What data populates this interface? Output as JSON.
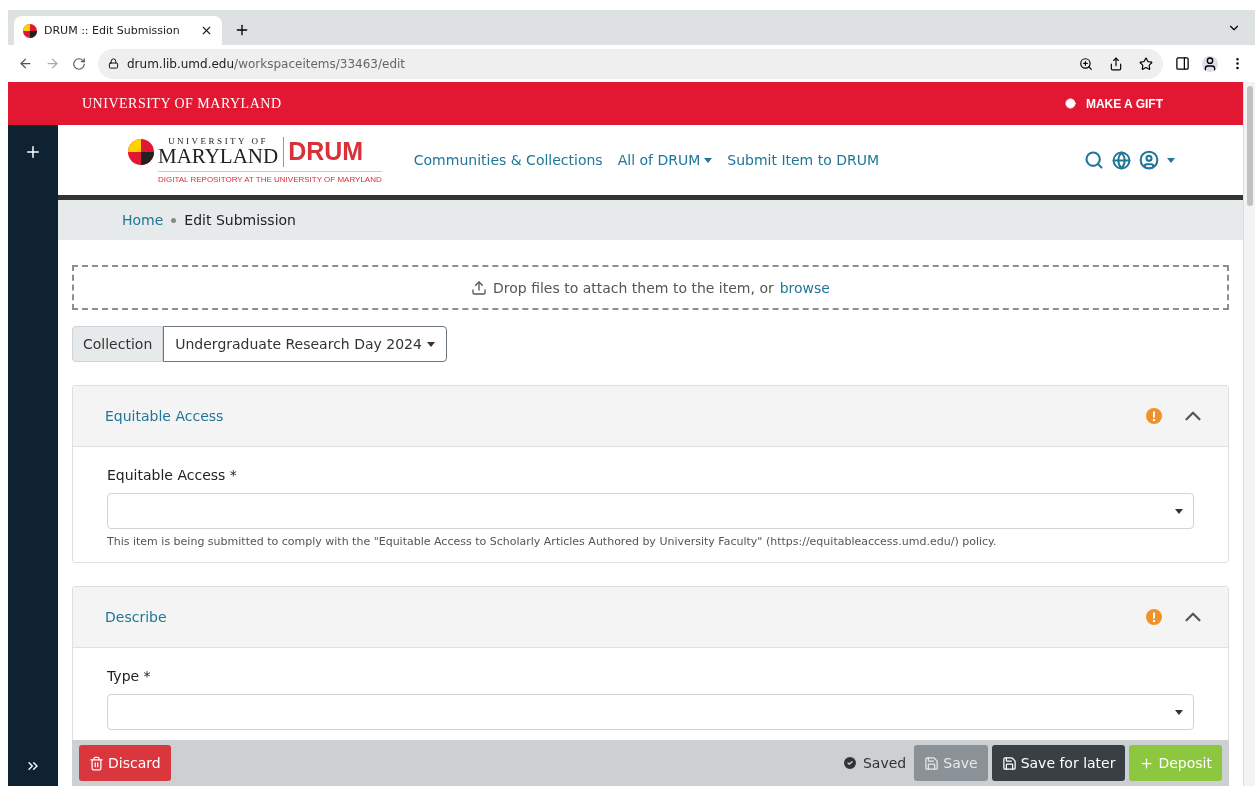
{
  "browser": {
    "tab_title": "DRUM :: Edit Submission",
    "url_host": "drum.lib.umd.edu",
    "url_path": "/workspaceitems/33463/edit"
  },
  "top_bar": {
    "title": "UNIVERSITY OF MARYLAND",
    "gift": "MAKE A GIFT"
  },
  "logo": {
    "line1": "UNIVERSITY OF",
    "line2": "MARYLAND",
    "brand": "DRUM",
    "tagline": "DIGITAL REPOSITORY AT THE UNIVERSITY OF MARYLAND"
  },
  "nav": [
    {
      "label": "Communities & Collections",
      "dropdown": false
    },
    {
      "label": "All of DRUM",
      "dropdown": true
    },
    {
      "label": "Submit Item to DRUM",
      "dropdown": false
    }
  ],
  "breadcrumb": [
    {
      "label": "Home",
      "link": true
    },
    {
      "label": "Edit Submission",
      "link": false
    }
  ],
  "dropzone": {
    "text": "Drop files to attach them to the item, or",
    "link": "browse"
  },
  "collection": {
    "label": "Collection",
    "value": "Undergraduate Research Day 2024"
  },
  "sections": [
    {
      "title": "Equitable Access",
      "expanded": true,
      "warning": true,
      "fields": [
        {
          "label": "Equitable Access *",
          "hint": "This item is being submitted to comply with the \"Equitable Access to Scholarly Articles Authored by University Faculty\" (https://equitableaccess.umd.edu/) policy."
        }
      ]
    },
    {
      "title": "Describe",
      "expanded": true,
      "warning": true,
      "fields": [
        {
          "label": "Type *"
        }
      ]
    }
  ],
  "footer": {
    "discard": "Discard",
    "status": "Saved",
    "saved": true,
    "save": {
      "label": "Save",
      "disabled": true
    },
    "save_later": "Save for later",
    "deposit": "Deposit"
  }
}
